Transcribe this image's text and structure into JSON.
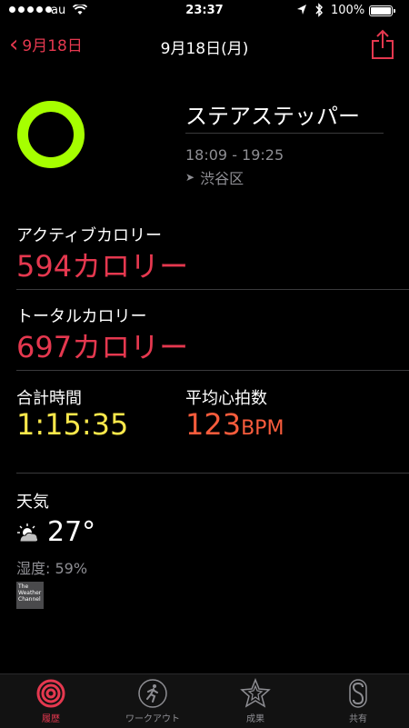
{
  "status_bar": {
    "carrier": "au",
    "time": "23:37",
    "battery": "100%"
  },
  "nav": {
    "back_label": "9月18日",
    "title": "9月18日(月)"
  },
  "workout": {
    "name": "ステアステッパー",
    "time_range": "18:09 - 19:25",
    "location": "渋谷区"
  },
  "metrics": {
    "active_calories": {
      "label": "アクティブカロリー",
      "value": "594カロリー"
    },
    "total_calories": {
      "label": "トータルカロリー",
      "value": "697カロリー"
    },
    "total_time": {
      "label": "合計時間",
      "value": "1:15:35"
    },
    "avg_heart_rate": {
      "label": "平均心拍数",
      "value": "123",
      "unit": "BPM"
    }
  },
  "weather": {
    "label": "天気",
    "temperature": "27°",
    "humidity": "湿度: 59%",
    "provider_logo_text": "The Weather Channel"
  },
  "tabs": [
    {
      "label": "履歴",
      "icon": "history-icon",
      "active": true
    },
    {
      "label": "ワークアウト",
      "icon": "workout-runner-icon",
      "active": false
    },
    {
      "label": "成果",
      "icon": "star-achievement-icon",
      "active": false
    },
    {
      "label": "共有",
      "icon": "sharing-icon",
      "active": false
    }
  ],
  "colors": {
    "accent_red": "#e5384f",
    "ring_green": "#a6ff00",
    "time_yellow": "#fce84b",
    "heart_orange": "#f85c3c"
  }
}
